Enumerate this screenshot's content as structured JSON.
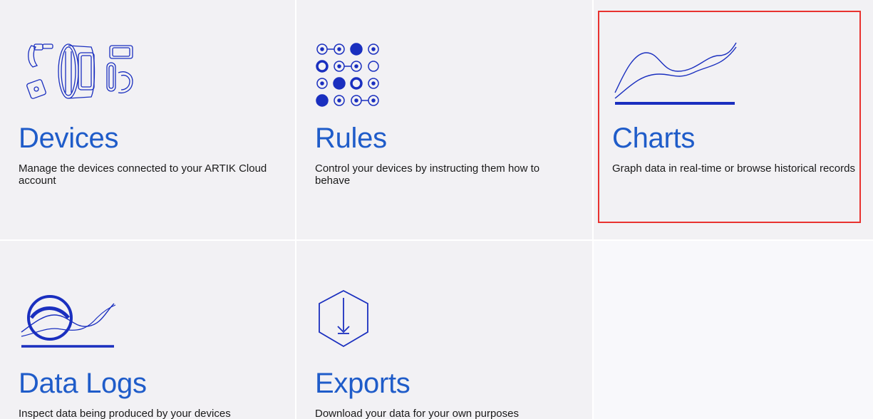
{
  "tiles": [
    {
      "id": "devices",
      "icon": "wearable-devices-icon",
      "title": "Devices",
      "description": "Manage the devices connected to your ARTIK Cloud account"
    },
    {
      "id": "rules",
      "icon": "rules-dots-icon",
      "title": "Rules",
      "description": "Control your devices by instructing them how to behave"
    },
    {
      "id": "charts",
      "icon": "line-chart-icon",
      "title": "Charts",
      "description": "Graph data in real-time or browse historical records"
    },
    {
      "id": "data-logs",
      "icon": "data-log-icon",
      "title": "Data Logs",
      "description": "Inspect data being produced by your devices"
    },
    {
      "id": "exports",
      "icon": "hexagon-download-icon",
      "title": "Exports",
      "description": "Download your data for your own purposes"
    }
  ],
  "highlight": {
    "target": "charts",
    "color": "#e8322f"
  },
  "colors": {
    "accent": "#1f5cc9",
    "icon_stroke": "#1a2fbf",
    "tile_bg": "#f2f1f4"
  }
}
